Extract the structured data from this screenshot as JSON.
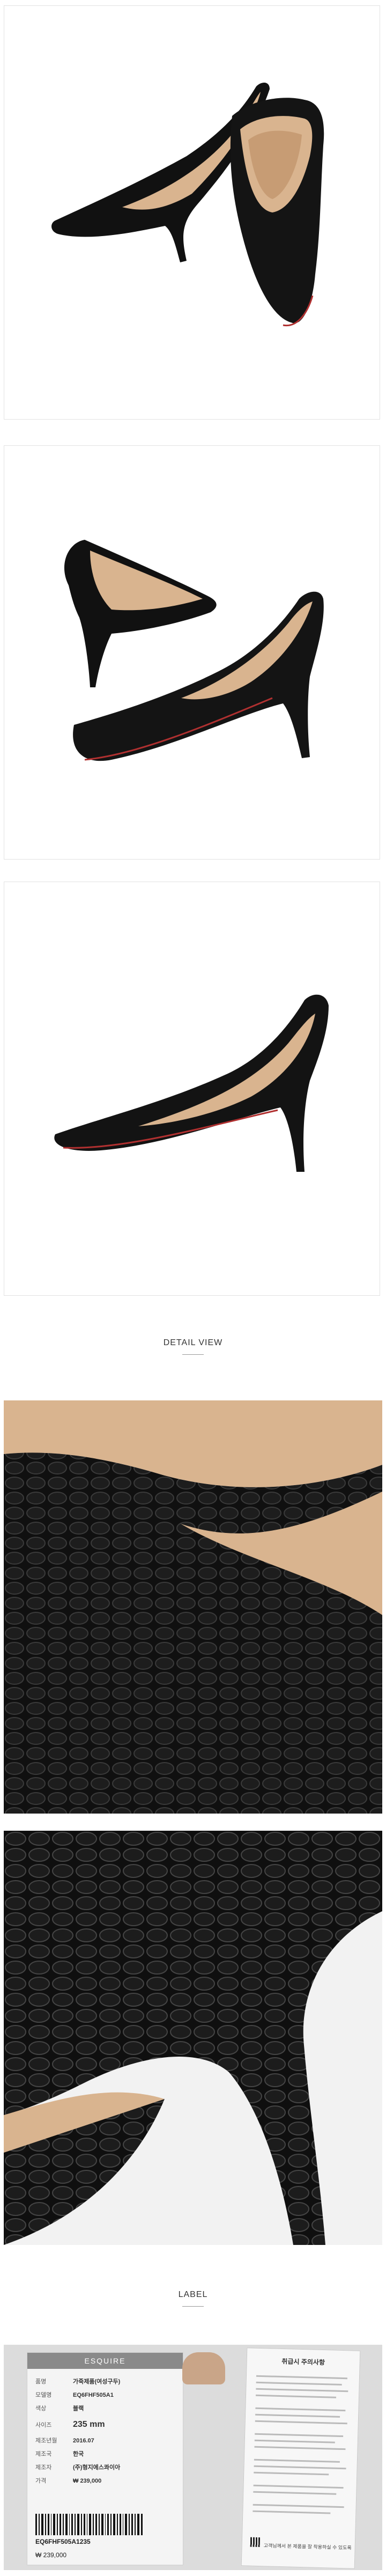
{
  "sections": {
    "detail_view": "DETAIL VIEW",
    "label": "LABEL"
  },
  "colors": {
    "shoe_leather": "#111111",
    "lining": "#d9b48f",
    "sole_red": "#b03030"
  },
  "label": {
    "brand": "ESQUIRE",
    "rows": [
      {
        "k": "품명",
        "v": "가죽제품(여성구두)"
      },
      {
        "k": "모델명",
        "v": "EQ6FHF505A1"
      },
      {
        "k": "색상",
        "v": "블랙"
      },
      {
        "k": "사이즈",
        "v": "235 mm"
      },
      {
        "k": "제조년월",
        "v": "2016.07"
      },
      {
        "k": "제조국",
        "v": "한국"
      },
      {
        "k": "제조자",
        "v": "(주)형지에스콰이아"
      },
      {
        "k": "가격",
        "v": "₩ 239,000"
      }
    ],
    "barcode_text": "EQ6FHF505A1235",
    "price_bottom": "₩ 239,000",
    "care_title": "취급시 주의사항",
    "care_note": "고객님께서 본 제품을 잘 착용하실 수 있도록"
  }
}
